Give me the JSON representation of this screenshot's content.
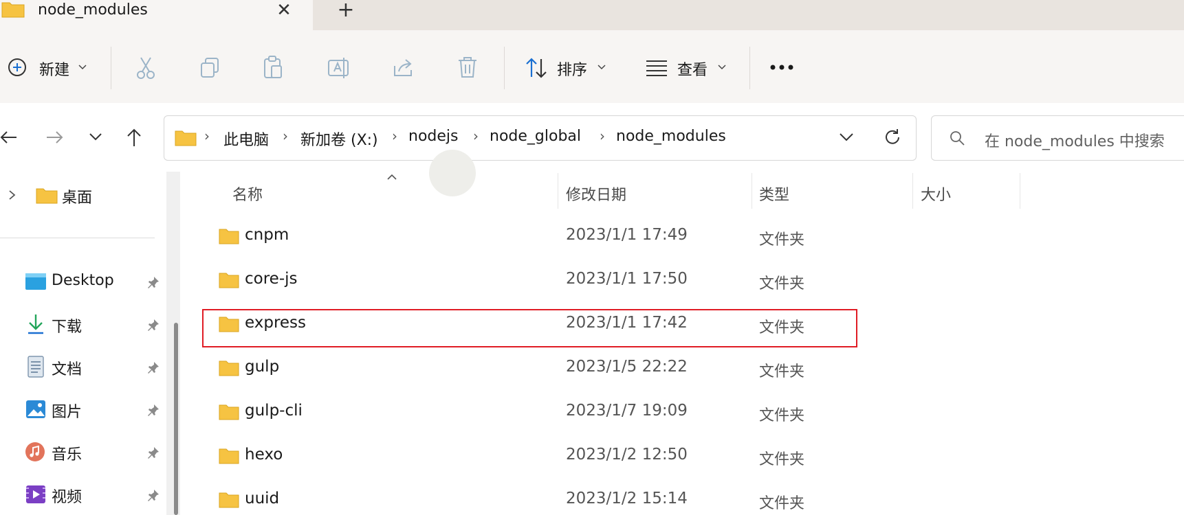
{
  "tab": {
    "title": "node_modules",
    "close_glyph": "✕",
    "add_glyph": "+"
  },
  "toolbar": {
    "new_label": "新建",
    "sort_label": "排序",
    "view_label": "查看",
    "more_glyph": "•••",
    "icons": [
      "plus-circle-icon",
      "cut-icon",
      "copy-icon",
      "paste-icon",
      "rename-icon",
      "share-icon",
      "delete-icon",
      "sort-icon",
      "view-icon",
      "more-icon"
    ]
  },
  "address": {
    "crumbs": [
      "此电脑",
      "新加卷 (X:)",
      "nodejs",
      "node_global",
      "node_modules"
    ],
    "separator": "›"
  },
  "search": {
    "placeholder": "在 node_modules 中搜索"
  },
  "nav": {
    "top_item": "桌面",
    "quick_access": [
      {
        "label": "Desktop",
        "icon": "desktop-icon"
      },
      {
        "label": "下载",
        "icon": "download-icon"
      },
      {
        "label": "文档",
        "icon": "document-icon"
      },
      {
        "label": "图片",
        "icon": "pictures-icon"
      },
      {
        "label": "音乐",
        "icon": "music-icon"
      },
      {
        "label": "视频",
        "icon": "video-icon"
      }
    ]
  },
  "columns": {
    "name": "名称",
    "modified": "修改日期",
    "type": "类型",
    "size": "大小"
  },
  "files": [
    {
      "name": "cnpm",
      "modified": "2023/1/1 17:49",
      "type": "文件夹"
    },
    {
      "name": "core-js",
      "modified": "2023/1/1 17:50",
      "type": "文件夹"
    },
    {
      "name": "express",
      "modified": "2023/1/1 17:42",
      "type": "文件夹"
    },
    {
      "name": "gulp",
      "modified": "2023/1/5 22:22",
      "type": "文件夹"
    },
    {
      "name": "gulp-cli",
      "modified": "2023/1/7 19:09",
      "type": "文件夹"
    },
    {
      "name": "hexo",
      "modified": "2023/1/2 12:50",
      "type": "文件夹"
    },
    {
      "name": "uuid",
      "modified": "2023/1/2 15:14",
      "type": "文件夹"
    }
  ],
  "colors": {
    "folder": "#f6c342",
    "highlight": "#e01b24",
    "accent": "#1a6fd1"
  }
}
